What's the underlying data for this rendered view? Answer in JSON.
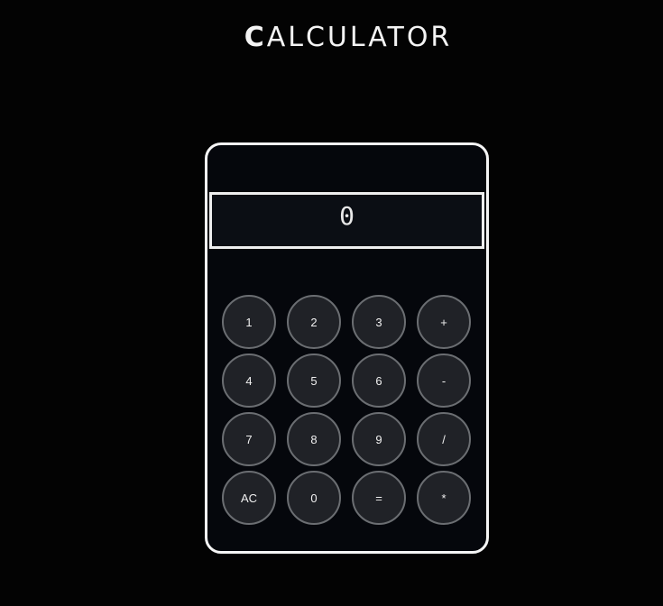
{
  "app": {
    "title_first": "C",
    "title_rest": "ALCULATOR"
  },
  "display": {
    "value": "0"
  },
  "keys": [
    {
      "label": "1"
    },
    {
      "label": "2"
    },
    {
      "label": "3"
    },
    {
      "label": "+"
    },
    {
      "label": "4"
    },
    {
      "label": "5"
    },
    {
      "label": "6"
    },
    {
      "label": "-"
    },
    {
      "label": "7"
    },
    {
      "label": "8"
    },
    {
      "label": "9"
    },
    {
      "label": "/"
    },
    {
      "label": "AC"
    },
    {
      "label": "0"
    },
    {
      "label": "="
    },
    {
      "label": "*"
    }
  ],
  "colors": {
    "background": "#030303",
    "panel": "#05070c",
    "key_fill": "#202227",
    "key_border": "#6b6e72",
    "border": "#f5f5f5"
  }
}
